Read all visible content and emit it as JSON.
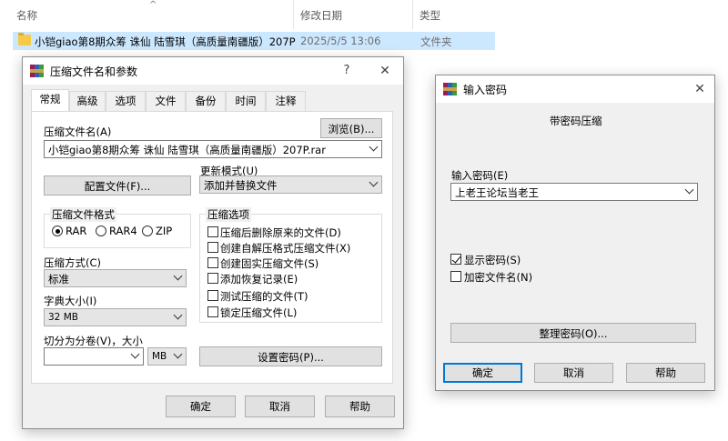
{
  "explorer": {
    "columns": {
      "name": "名称",
      "date": "修改日期",
      "type": "类型"
    },
    "sort_indicator": "^",
    "row": {
      "name": "小铠giao第8期众筹 诛仙 陆雪琪（高质量南疆版）207P",
      "date": "2025/5/5 13:06",
      "type": "文件夹"
    }
  },
  "archive_dialog": {
    "title": "压缩文件名和参数",
    "help_btn": "?",
    "close_btn": "✕",
    "tabs": [
      "常规",
      "高级",
      "选项",
      "文件",
      "备份",
      "时间",
      "注释"
    ],
    "archive_name_label": "压缩文件名(A)",
    "browse_btn": "浏览(B)...",
    "archive_name_value": "小铠giao第8期众筹 诛仙 陆雪琪（高质量南疆版）207P.rar",
    "profile_btn": "配置文件(F)...",
    "update_mode_label": "更新模式(U)",
    "update_mode_value": "添加并替换文件",
    "format_group": "压缩文件格式",
    "formats": [
      "RAR",
      "RAR4",
      "ZIP"
    ],
    "options_group": "压缩选项",
    "options": [
      "压缩后删除原来的文件(D)",
      "创建自解压格式压缩文件(X)",
      "创建固实压缩文件(S)",
      "添加恢复记录(E)",
      "测试压缩的文件(T)",
      "锁定压缩文件(L)"
    ],
    "method_label": "压缩方式(C)",
    "method_value": "标准",
    "dict_label": "字典大小(I)",
    "dict_value": "32 MB",
    "split_label": "切分为分卷(V)，大小",
    "split_value": "",
    "split_unit": "MB",
    "set_password_btn": "设置密码(P)...",
    "ok_btn": "确定",
    "cancel_btn": "取消",
    "help_btn2": "帮助"
  },
  "password_dialog": {
    "title": "输入密码",
    "close_btn": "✕",
    "heading": "带密码压缩",
    "password_label": "输入密码(E)",
    "password_value": "上老王论坛当老王",
    "show_password": "显示密码(S)",
    "show_password_checked": true,
    "encrypt_names": "加密文件名(N)",
    "encrypt_names_checked": false,
    "organize_btn": "整理密码(O)...",
    "ok_btn": "确定",
    "cancel_btn": "取消",
    "help_btn": "帮助"
  }
}
